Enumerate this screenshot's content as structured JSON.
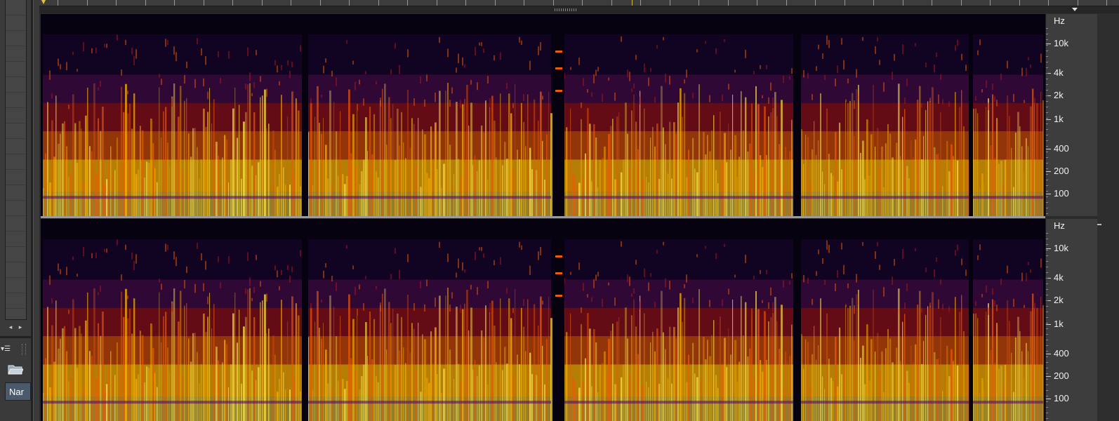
{
  "left_panel": {
    "scroll_left_glyph": "◂",
    "scroll_right_glyph": "▸",
    "panel_menu_glyph": "▾☰",
    "name_column_label": "Nar",
    "icons": [
      "scroll-left-icon",
      "scroll-right-icon",
      "panel-menu-icon",
      "open-folder-icon"
    ]
  },
  "timeline": {
    "playhead_icon": "playhead-marker-icon",
    "zoom_menu_icon": "chevron-down-icon"
  },
  "spectral_display": {
    "unit_label": "Hz",
    "frequency_ticks": [
      "10k",
      "4k",
      "2k",
      "1k",
      "400",
      "200",
      "100"
    ],
    "channels": [
      "channel-1",
      "channel-2"
    ],
    "colors": {
      "background": "#07020f",
      "low": "#1a0633",
      "mid_low": "#5a0e5e",
      "mid": "#b1151e",
      "mid_high": "#f05a06",
      "high": "#ffb400",
      "peak": "#ffe84a"
    }
  }
}
